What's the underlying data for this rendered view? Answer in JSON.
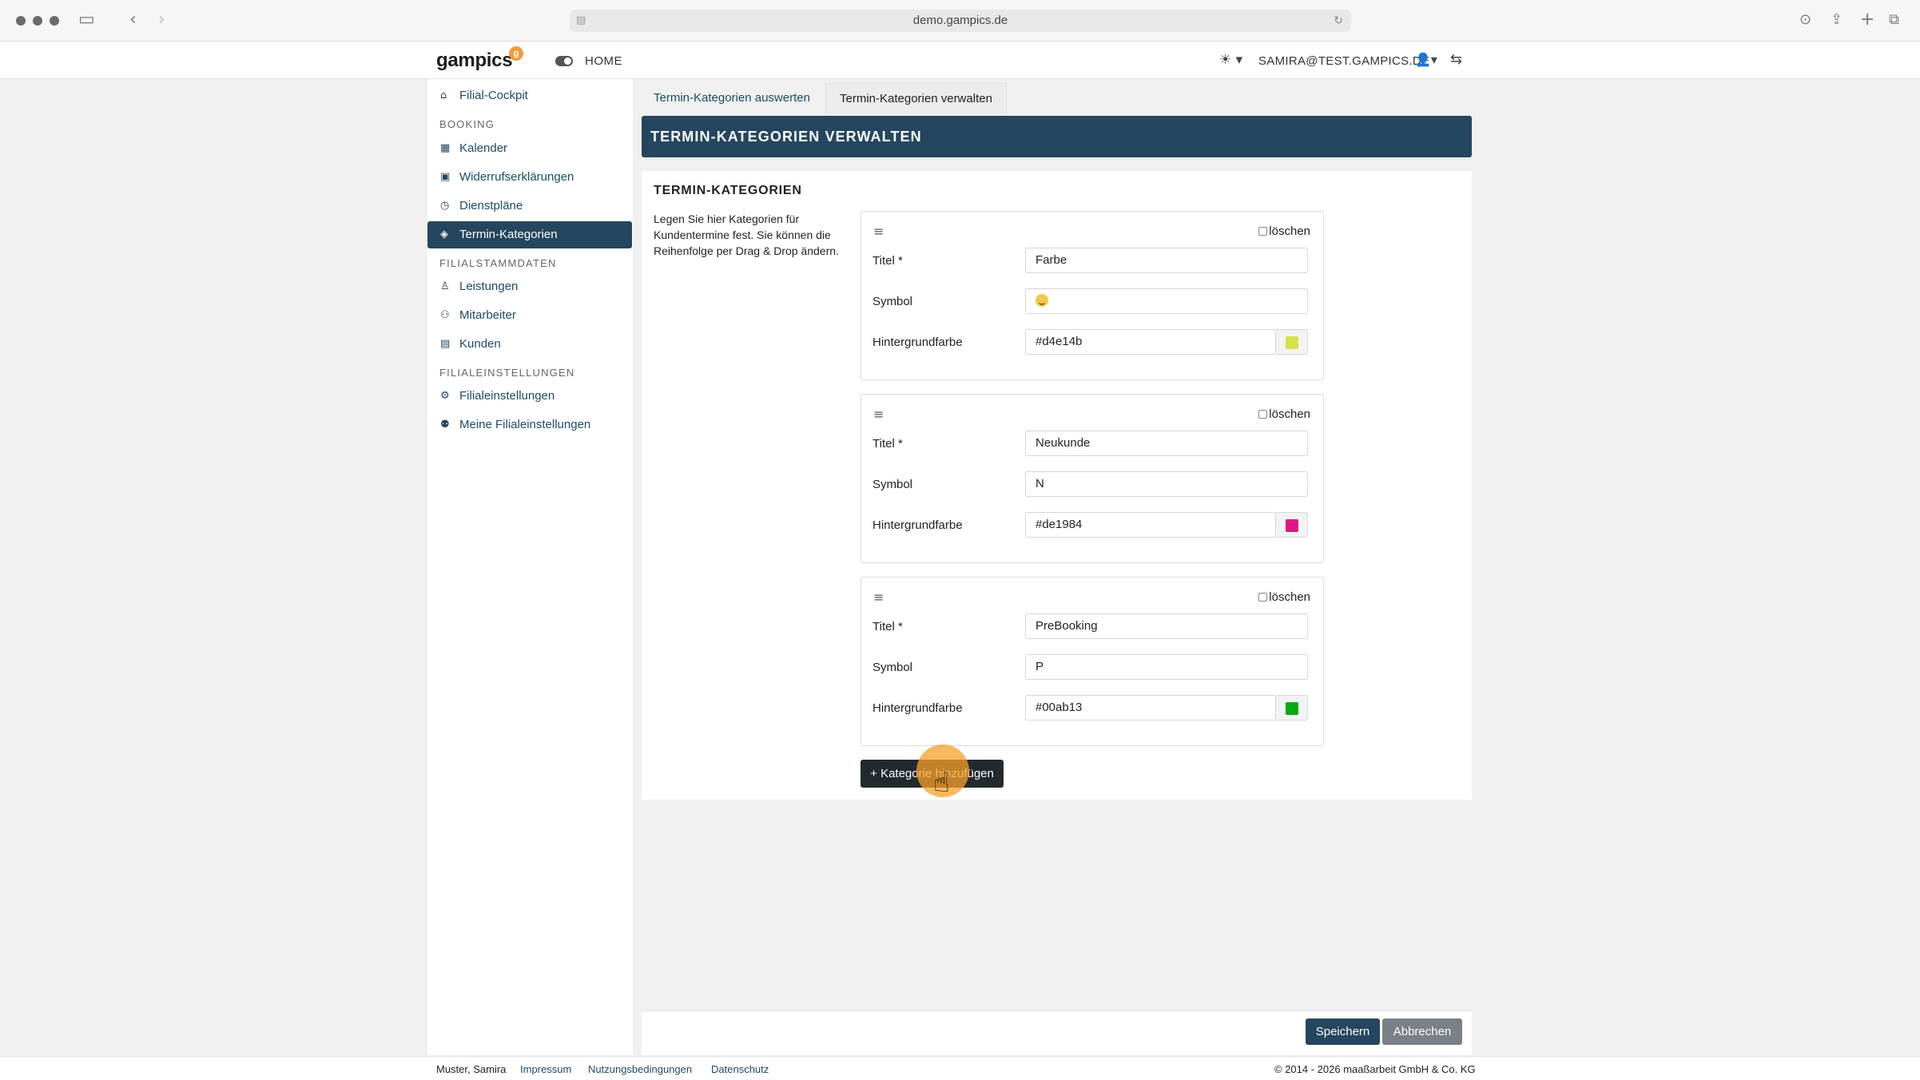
{
  "browser": {
    "url": "demo.gampics.de"
  },
  "navbar": {
    "logo": "gampics",
    "home_label": "HOME",
    "user_label": "SAMIRA@TEST.GAMPICS.DE"
  },
  "sidebar": {
    "items": [
      {
        "label": "Filial-Cockpit",
        "icon": "home-icon"
      },
      {
        "label": "Kalender",
        "icon": "calendar-icon"
      },
      {
        "label": "Widerrufserklärungen",
        "icon": "document-icon"
      },
      {
        "label": "Dienstpläne",
        "icon": "clock-icon"
      },
      {
        "label": "Termin-Kategorien",
        "icon": "tags-icon",
        "active": true
      },
      {
        "label": "Leistungen",
        "icon": "chair-icon"
      },
      {
        "label": "Mitarbeiter",
        "icon": "users-icon"
      },
      {
        "label": "Kunden",
        "icon": "contact-icon"
      },
      {
        "label": "Filialeinstellungen",
        "icon": "settings-icon"
      },
      {
        "label": "Meine Filialeinstellungen",
        "icon": "user-settings-icon"
      }
    ],
    "headings": {
      "booking": "BOOKING",
      "stammdaten": "FILIALSTAMMDATEN",
      "einstellungen": "FILIALEINSTELLUNGEN"
    }
  },
  "tabs": [
    {
      "label": "Termin-Kategorien auswerten",
      "active": false
    },
    {
      "label": "Termin-Kategorien verwalten",
      "active": true
    }
  ],
  "page": {
    "banner": "TERMIN-KATEGORIEN VERWALTEN",
    "section_title": "TERMIN-KATEGORIEN",
    "description": "Legen Sie hier Kategorien für Kundentermine fest. Sie können die Reihenfolge per Drag & Drop ändern."
  },
  "form_labels": {
    "title": "Titel *",
    "symbol": "Symbol",
    "color": "Hintergrundfarbe",
    "delete": "löschen"
  },
  "categories": [
    {
      "title": "Farbe",
      "symbol": "😊",
      "color": "#d4e14b"
    },
    {
      "title": "Neukunde",
      "symbol": "N",
      "color": "#de1984"
    },
    {
      "title": "PreBooking",
      "symbol": "P",
      "color": "#00ab13"
    }
  ],
  "actions": {
    "add_category": "+ Kategorie hinzufügen",
    "save": "Speichern",
    "cancel": "Abbrechen"
  },
  "footer": {
    "user": "Muster, Samira",
    "links": [
      "Impressum",
      "Nutzungsbedingungen",
      "Datenschutz"
    ],
    "copyright": "© 2014 - 2026 maaßarbeit GmbH & Co. KG"
  }
}
